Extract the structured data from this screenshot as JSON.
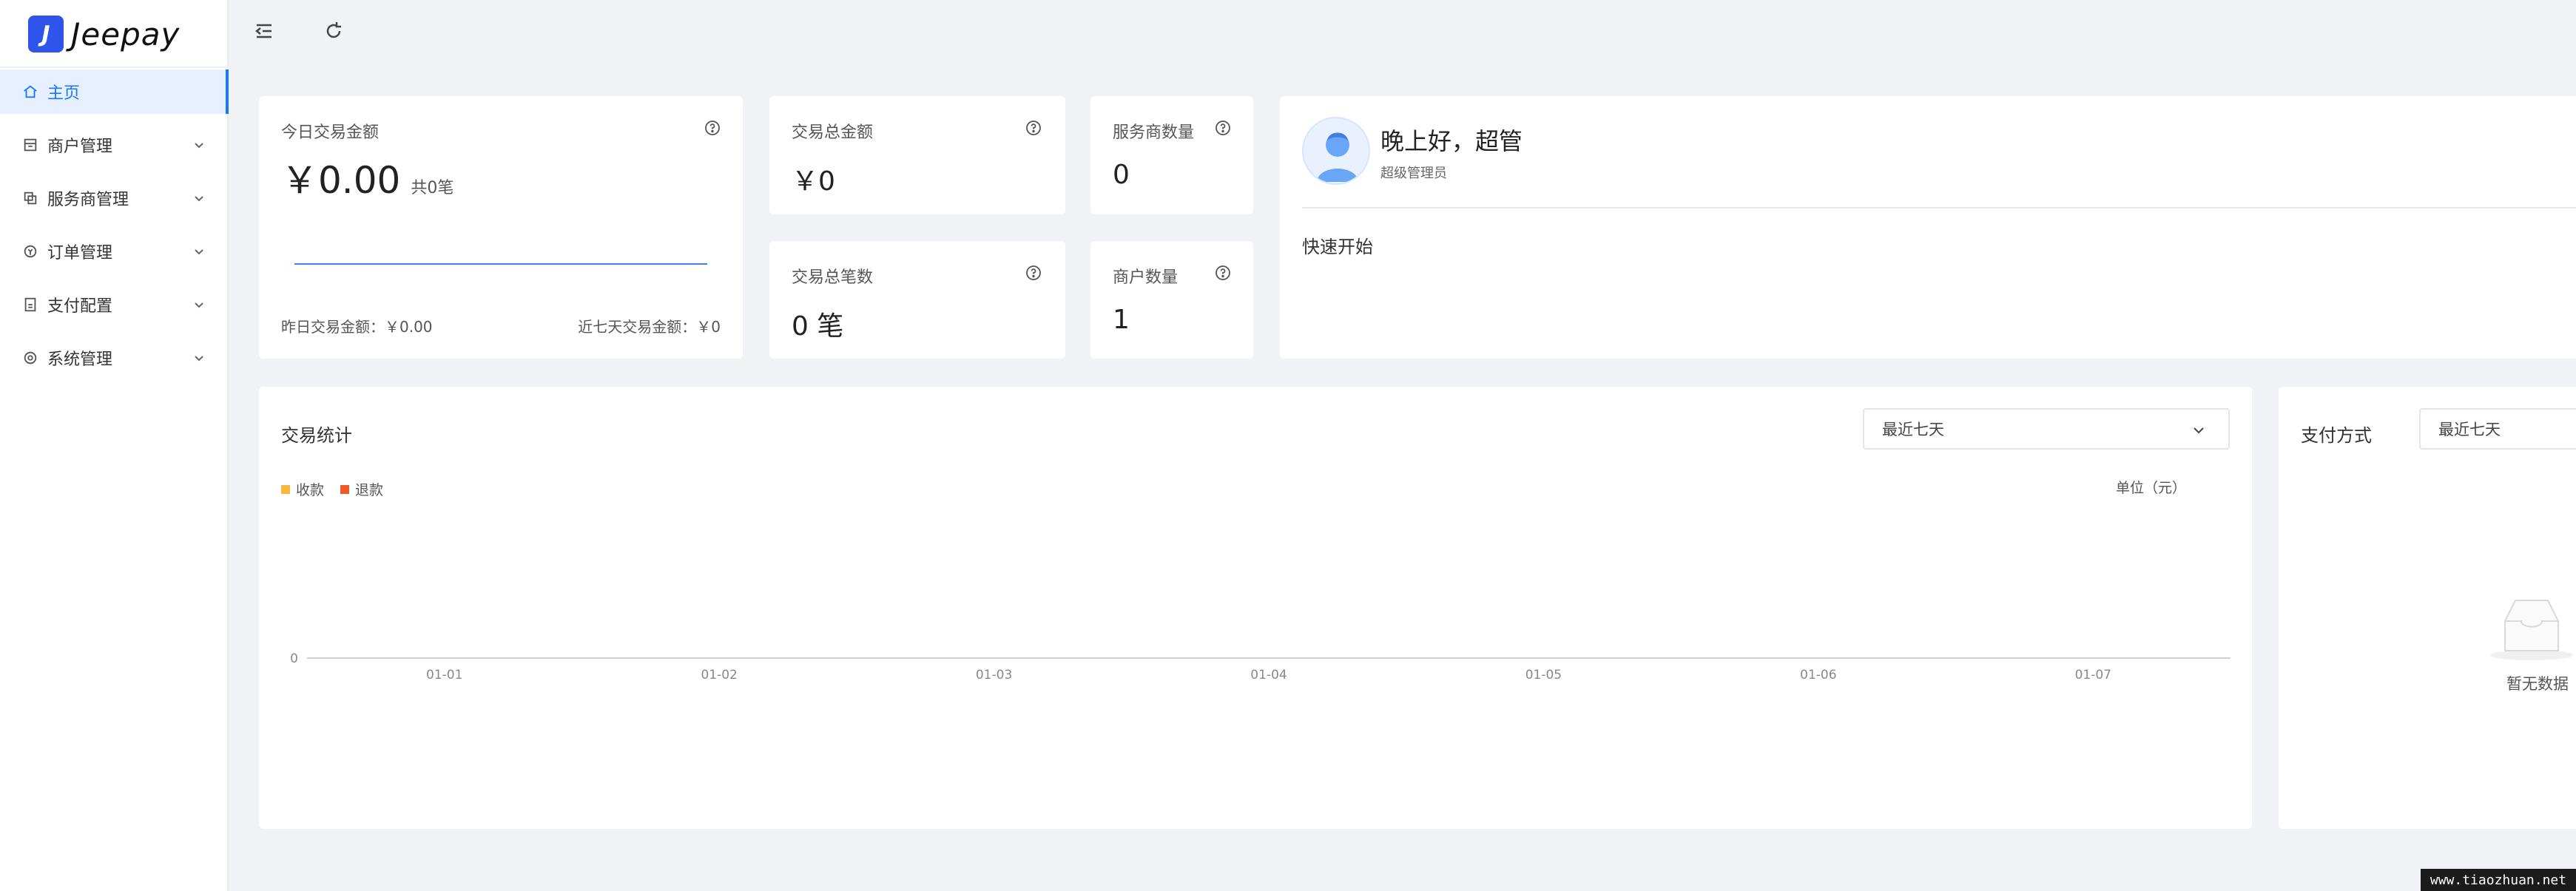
{
  "brand": {
    "name": "Jeepay",
    "accent": "#1677ff"
  },
  "sidebar": {
    "items": [
      {
        "label": "主页",
        "icon": "home-icon",
        "active": true
      },
      {
        "label": "商户管理",
        "icon": "shop-icon"
      },
      {
        "label": "服务商管理",
        "icon": "copy-icon"
      },
      {
        "label": "订单管理",
        "icon": "account-book-icon"
      },
      {
        "label": "支付配置",
        "icon": "file-icon"
      },
      {
        "label": "系统管理",
        "icon": "setting-icon"
      }
    ]
  },
  "topbar": {
    "icons": [
      "menu-fold-icon",
      "reload-icon"
    ]
  },
  "stats": {
    "today": {
      "title": "今日交易金额",
      "amount": "￥0.00",
      "count": "共0笔",
      "yesterday": "昨日交易金额：￥0.00",
      "last7": "近七天交易金额：￥0"
    },
    "total_amount": {
      "title": "交易总金额",
      "value": "￥0"
    },
    "provider_count": {
      "title": "服务商数量",
      "value": "0"
    },
    "total_count": {
      "title": "交易总笔数",
      "value": "0 笔"
    },
    "merchant_count": {
      "title": "商户数量",
      "value": "1"
    }
  },
  "welcome": {
    "title": "晚上好，超管",
    "subtitle": "超级管理员",
    "quick_start": "快速开始"
  },
  "trade_stats": {
    "title": "交易统计",
    "range": "最近七天",
    "unit": "单位（元）",
    "legend": [
      {
        "name": "收款",
        "color": "#f6b93b"
      },
      {
        "name": "退款",
        "color": "#ee5a24"
      }
    ]
  },
  "chart_data": {
    "type": "bar",
    "title": "交易统计",
    "categories": [
      "01-01",
      "01-02",
      "01-03",
      "01-04",
      "01-05",
      "01-06",
      "01-07"
    ],
    "series": [
      {
        "name": "收款",
        "values": [
          0,
          0,
          0,
          0,
          0,
          0,
          0
        ]
      },
      {
        "name": "退款",
        "values": [
          0,
          0,
          0,
          0,
          0,
          0,
          0
        ]
      }
    ],
    "yticks": [
      "0"
    ],
    "ylabel": "",
    "xlabel": "",
    "legend_position": "top-left"
  },
  "payment_method": {
    "title": "支付方式",
    "range": "最近七天",
    "empty_text": "暂无数据"
  },
  "watermark": "www.tiaozhuan.net"
}
